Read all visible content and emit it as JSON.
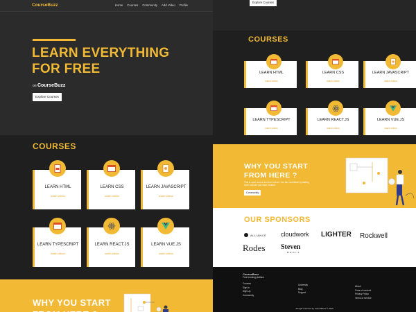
{
  "brand": "CourseBuzz",
  "nav": [
    "Home",
    "Courses",
    "Community",
    "Add Video",
    "Profile"
  ],
  "hero": {
    "title_line1": "LEARN EVERYTHING",
    "title_line2": "FOR FREE",
    "on_prefix": "on",
    "on_brand": "CourseBuzz",
    "button": "Explore Courses"
  },
  "courses_title": "COURSES",
  "courses": [
    {
      "name": "LEARN HTML",
      "link": "watch videos",
      "icon": "html-file-icon"
    },
    {
      "name": "LEARN CSS",
      "link": "watch videos",
      "icon": "css-window-icon"
    },
    {
      "name": "LEARN JAVASCRIPT",
      "link": "watch videos",
      "icon": "js-file-icon"
    },
    {
      "name": "LEARN TYPESCRIPT",
      "link": "watch videos",
      "icon": "ts-window-icon"
    },
    {
      "name": "LEARN REACT.JS",
      "link": "watch videos",
      "icon": "react-atom-icon"
    },
    {
      "name": "LEARN VUE.JS",
      "link": "watch videos",
      "icon": "vue-logo-icon"
    }
  ],
  "why": {
    "title_line1": "WHY YOU START",
    "title_line2": "FROM HERE ?",
    "text": "This is open source and free forever. You can contribute by adding more courses you have created.",
    "button": "Community"
  },
  "sponsors_title": "OUR SPONSORS",
  "sponsors": [
    "ALLIANCE",
    "cloudwork",
    "LIGHTER",
    "Rockwell",
    "Rodes",
    "Steven",
    "MEDIA"
  ],
  "footer": {
    "brand": "CourseBuzz",
    "tagline": "Free learning platform",
    "col1": [
      "Courses",
      "Sign in",
      "Sign Up",
      "Community"
    ],
    "col2": [
      "University",
      "Blog",
      "Support"
    ],
    "col3": [
      "About",
      "Code of conduct",
      "Privacy Policy",
      "Terms of Service"
    ],
    "copyright": "All right reserved by CourseBuzz © 2020"
  },
  "colors": {
    "accent": "#f1b934",
    "dark": "#1f1f1f",
    "hero": "#2b2b2b",
    "footer": "#101010"
  }
}
